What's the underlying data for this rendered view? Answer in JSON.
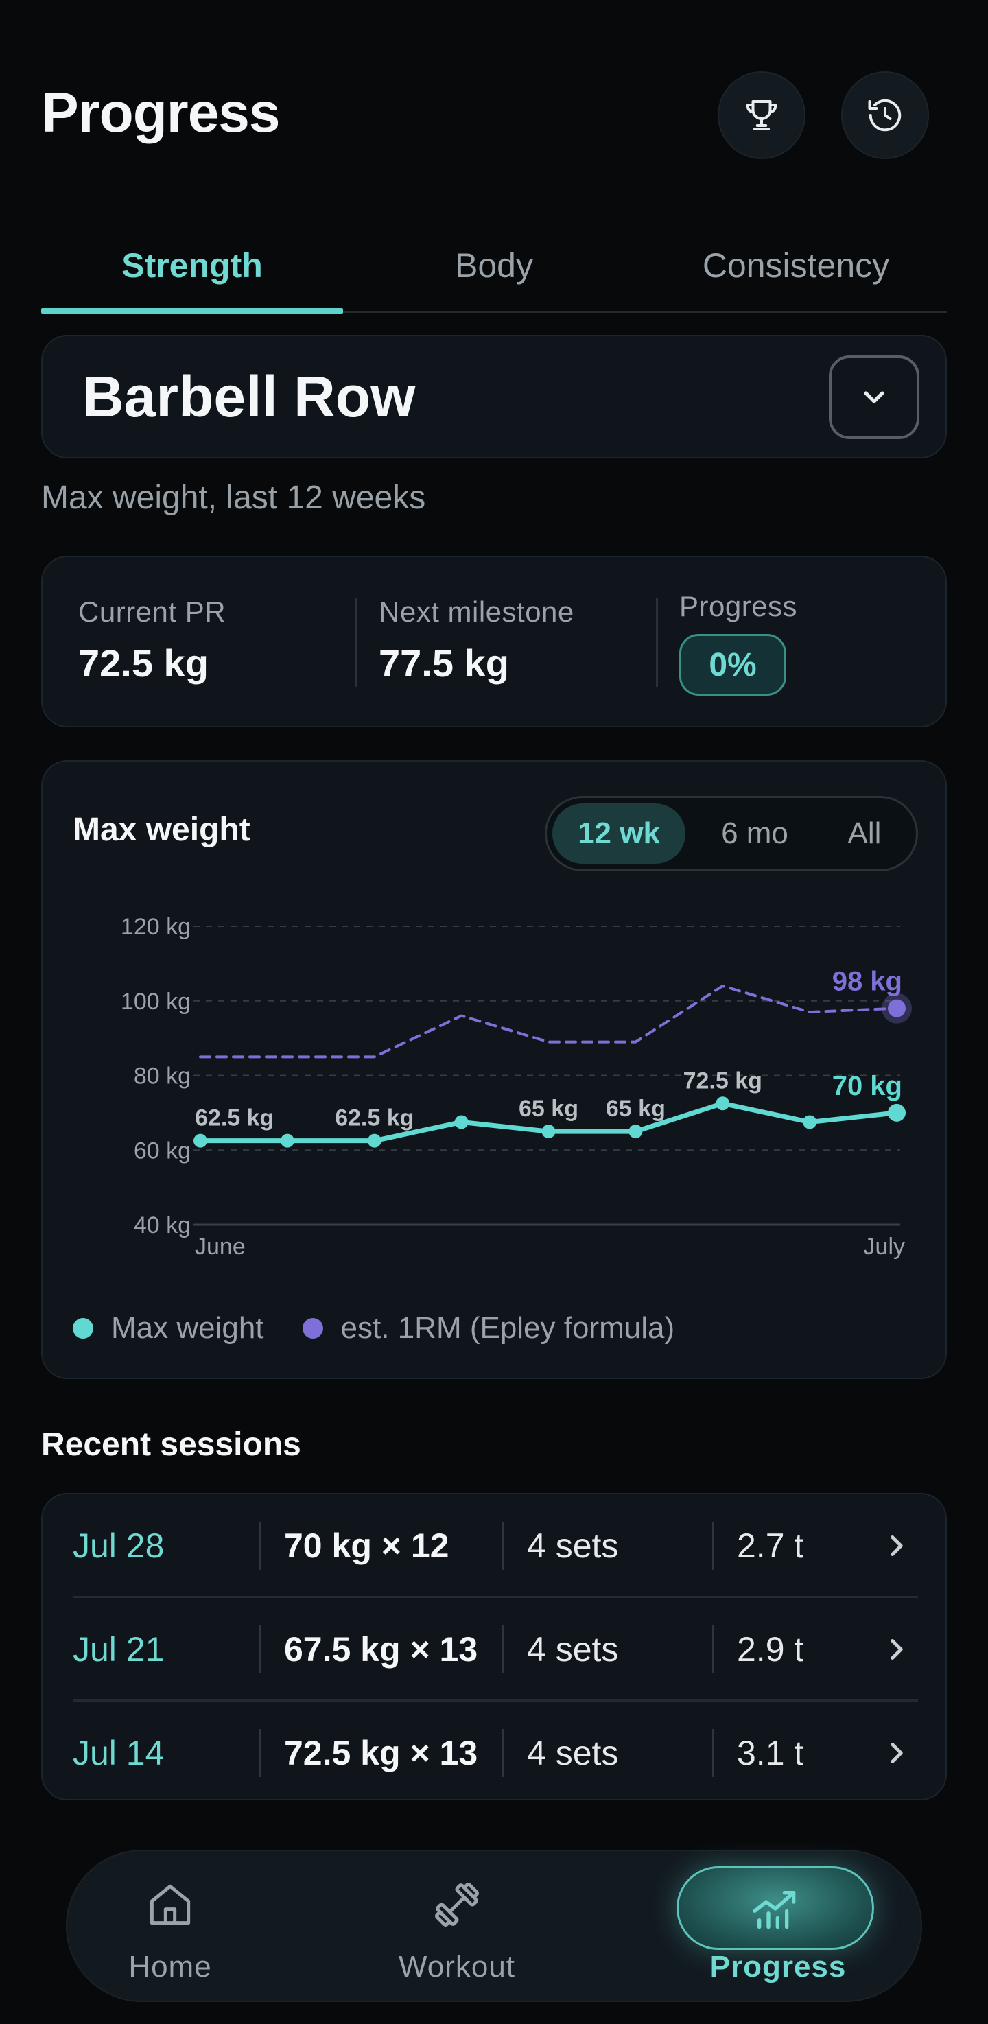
{
  "header": {
    "title": "Progress",
    "icons": [
      "trophy-icon",
      "history-icon"
    ]
  },
  "tabs": [
    {
      "label": "Strength",
      "active": true
    },
    {
      "label": "Body",
      "active": false
    },
    {
      "label": "Consistency",
      "active": false
    }
  ],
  "exercise": {
    "name": "Barbell Row"
  },
  "subtitle": "Max weight, last 12 weeks",
  "stats": {
    "current_pr": {
      "label": "Current PR",
      "value": "72.5 kg"
    },
    "next_milestone": {
      "label": "Next milestone",
      "value": "77.5 kg"
    },
    "progress": {
      "label": "Progress",
      "value": "0%"
    }
  },
  "chart_card": {
    "title": "Max weight",
    "ranges": [
      {
        "label": "12 wk",
        "active": true
      },
      {
        "label": "6 mo",
        "active": false
      },
      {
        "label": "All",
        "active": false
      }
    ]
  },
  "chart_data": {
    "type": "line",
    "x": [
      1,
      2,
      3,
      4,
      5,
      6,
      7,
      8,
      9
    ],
    "x_tick_labels": [
      {
        "at": 1,
        "label": "June"
      },
      {
        "at": 9,
        "label": "July"
      }
    ],
    "ylim": [
      40,
      120
    ],
    "yticks": [
      40,
      60,
      80,
      100,
      120
    ],
    "ytick_labels": [
      "40 kg",
      "60 kg",
      "80 kg",
      "100 kg",
      "120 kg"
    ],
    "grid": true,
    "series": [
      {
        "name": "Max weight",
        "color": "#5fd9d2",
        "style": "solid",
        "values": [
          62.5,
          62.5,
          62.5,
          67.5,
          65,
          65,
          72.5,
          67.5,
          70
        ],
        "point_labels": [
          "62.5 kg",
          "",
          "62.5 kg",
          "",
          "65 kg",
          "65 kg",
          "72.5 kg",
          "",
          "70 kg"
        ]
      },
      {
        "name": "est. 1RM (Epley formula)",
        "color": "#7f6fd8",
        "style": "dashed",
        "values": [
          85,
          85,
          85,
          96,
          89,
          89,
          104,
          97,
          98
        ],
        "point_labels": [
          "",
          "",
          "",
          "",
          "",
          "",
          "",
          "",
          "98 kg"
        ]
      }
    ],
    "legend_placement": "bottom-left"
  },
  "recent": {
    "title": "Recent sessions",
    "rows": [
      {
        "date": "Jul 28",
        "weight": "70 kg × 12",
        "sets": "4 sets",
        "volume": "2.7 t"
      },
      {
        "date": "Jul 21",
        "weight": "67.5 kg × 13",
        "sets": "4 sets",
        "volume": "2.9 t"
      },
      {
        "date": "Jul 14",
        "weight": "72.5 kg × 13",
        "sets": "4 sets",
        "volume": "3.1 t"
      }
    ]
  },
  "nav": [
    {
      "label": "Home",
      "icon": "home-icon",
      "active": false
    },
    {
      "label": "Workout",
      "icon": "dumbbell-icon",
      "active": false
    },
    {
      "label": "Progress",
      "icon": "chart-icon",
      "active": true
    }
  ],
  "colors": {
    "accent": "#5fd3cb",
    "secondary": "#7f6fd8",
    "background": "#08090b",
    "card": "#0f151a"
  }
}
